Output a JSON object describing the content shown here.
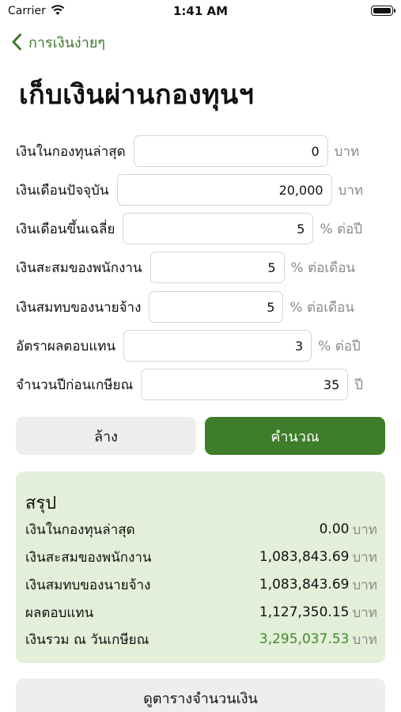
{
  "status_bar": {
    "carrier": "Carrier",
    "time": "1:41 AM"
  },
  "nav": {
    "back_label": "การเงินง่ายๆ"
  },
  "page_title": "เก็บเงินผ่านกองทุนฯ",
  "form": {
    "fields": [
      {
        "label": "เงินในกองทุนล่าสุด",
        "value": "0",
        "unit": "บาท"
      },
      {
        "label": "เงินเดือนปัจจุบัน",
        "value": "20,000",
        "unit": "บาท"
      },
      {
        "label": "เงินเดือนขึ้นเฉลี่ย",
        "value": "5",
        "unit": "% ต่อปี"
      },
      {
        "label": "เงินสะสมของพนักงาน",
        "value": "5",
        "unit": "% ต่อเดือน"
      },
      {
        "label": "เงินสมทบของนายจ้าง",
        "value": "5",
        "unit": "% ต่อเดือน"
      },
      {
        "label": "อัตราผลตอบแทน",
        "value": "3",
        "unit": "% ต่อปี"
      },
      {
        "label": "จำนวนปีก่อนเกษียณ",
        "value": "35",
        "unit": "ปี"
      }
    ]
  },
  "buttons": {
    "clear": "ล้าง",
    "calculate": "คำนวณ",
    "view_table": "ดูตารางจำนวนเงิน"
  },
  "summary": {
    "title": "สรุป",
    "currency": "บาท",
    "rows": [
      {
        "label": "เงินในกองทุนล่าสุด",
        "value": "0.00"
      },
      {
        "label": "เงินสะสมของพนักงาน",
        "value": "1,083,843.69"
      },
      {
        "label": "เงินสมทบของนายจ้าง",
        "value": "1,083,843.69"
      },
      {
        "label": "ผลตอบแทน",
        "value": "1,127,350.15"
      },
      {
        "label": "เงินรวม ณ วันเกษียณ",
        "value": "3,295,037.53"
      }
    ]
  },
  "colors": {
    "accent": "#3e7d2a",
    "summary_bg": "#e3efd9",
    "secondary_btn": "#eeeef0"
  }
}
